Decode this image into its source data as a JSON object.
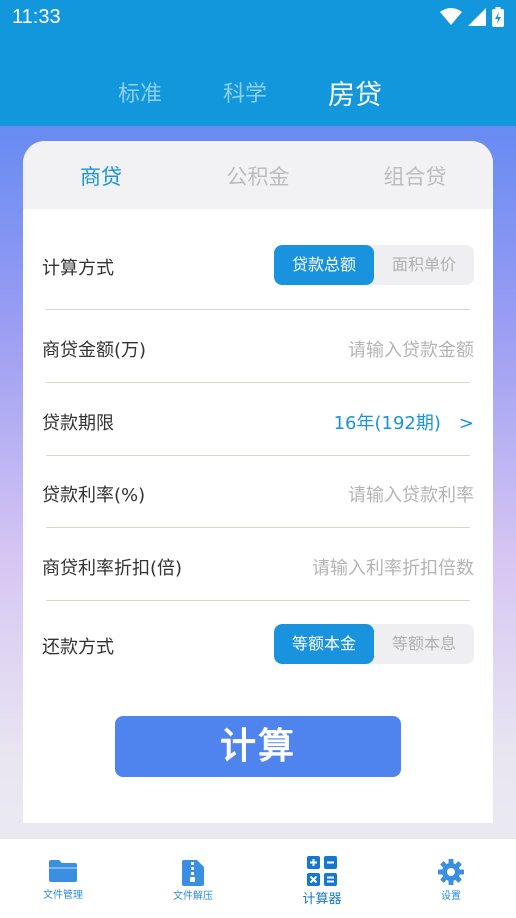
{
  "status_bar": {
    "time": "11:33"
  },
  "mode_tabs": [
    {
      "label": "标准"
    },
    {
      "label": "科学"
    },
    {
      "label": "房贷"
    }
  ],
  "loan_tabs": [
    {
      "label": "商贷"
    },
    {
      "label": "公积金"
    },
    {
      "label": "组合贷"
    }
  ],
  "form": {
    "calc_method": {
      "label": "计算方式",
      "options": [
        "贷款总额",
        "面积单价"
      ],
      "selected": "贷款总额"
    },
    "loan_amount": {
      "label": "商贷金额(万)",
      "placeholder": "请输入贷款金额"
    },
    "loan_term": {
      "label": "贷款期限",
      "value": "16年(192期)",
      "chevron": ">"
    },
    "interest_rate": {
      "label": "贷款利率(%)",
      "placeholder": "请输入贷款利率"
    },
    "rate_discount": {
      "label": "商贷利率折扣(倍)",
      "placeholder": "请输入利率折扣倍数"
    },
    "repay_method": {
      "label": "还款方式",
      "options": [
        "等额本金",
        "等额本息"
      ],
      "selected": "等额本金"
    }
  },
  "calculate_button": {
    "label": "计算"
  },
  "bottom_nav": [
    {
      "label": "文件管理",
      "icon": "folder-icon"
    },
    {
      "label": "文件解压",
      "icon": "zip-icon"
    },
    {
      "label": "计算器",
      "icon": "calculator-icon"
    },
    {
      "label": "设置",
      "icon": "gear-icon"
    }
  ],
  "colors": {
    "header": "#1297dd",
    "accent": "#1993dd",
    "button": "#4f84ef"
  }
}
